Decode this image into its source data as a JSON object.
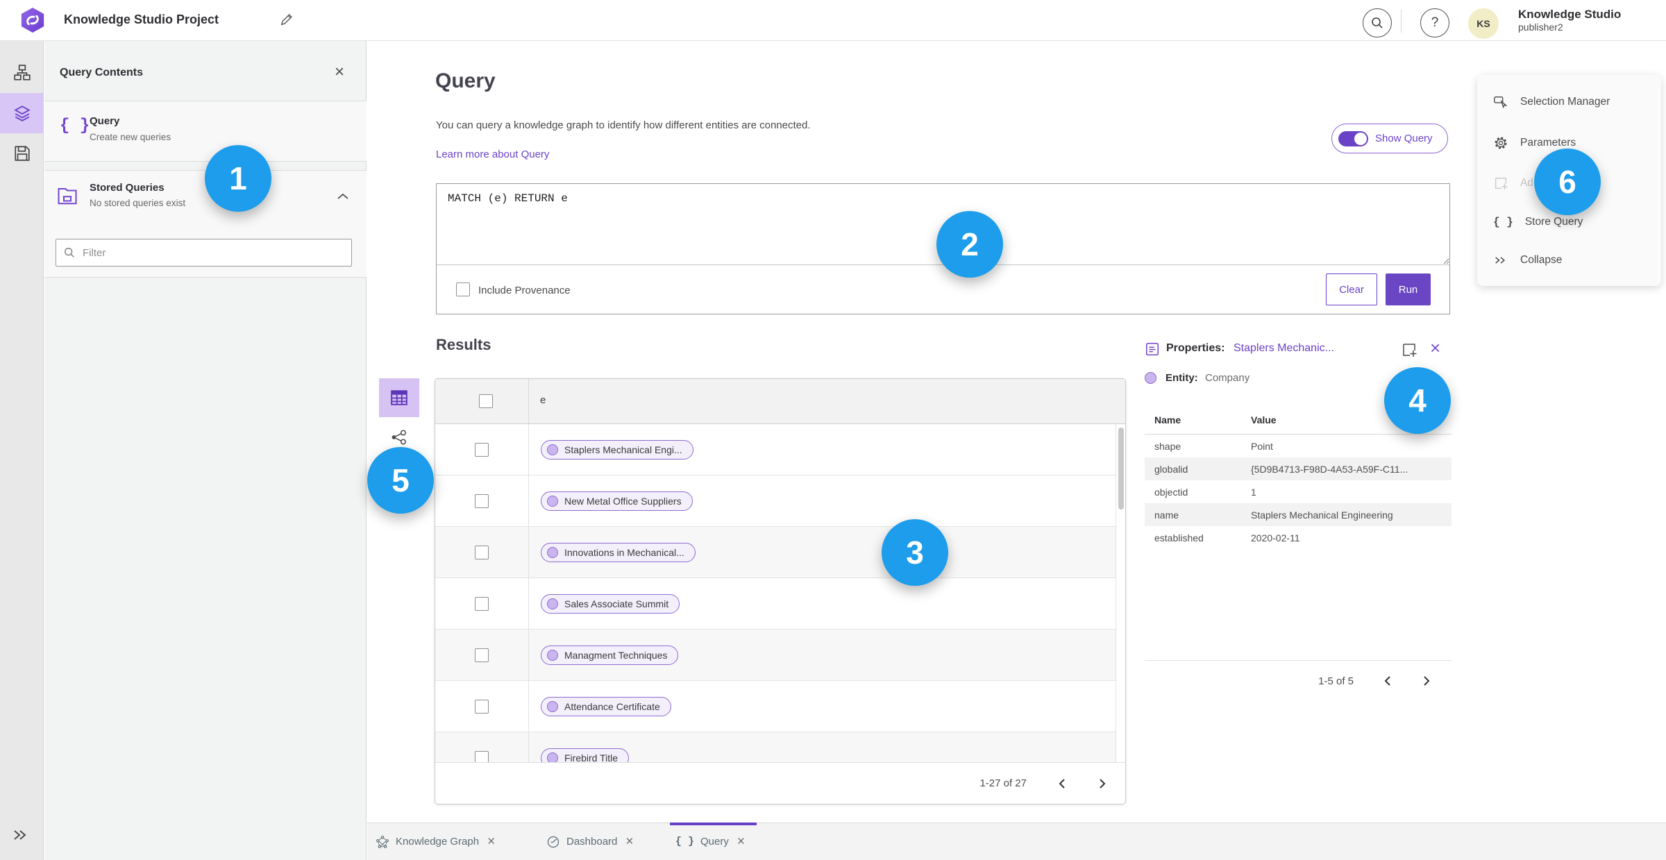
{
  "topbar": {
    "title": "Knowledge Studio Project",
    "user_name": "Knowledge Studio",
    "user_role": "publisher2",
    "avatar": "KS",
    "help_glyph": "?"
  },
  "sidebar": {
    "title": "Query Contents",
    "query_item": {
      "title": "Query",
      "subtitle": "Create new queries"
    },
    "stored_item": {
      "title": "Stored Queries",
      "subtitle": "No stored queries exist"
    },
    "filter_placeholder": "Filter",
    "braces_glyph": "{ }"
  },
  "query_panel": {
    "title": "Query",
    "description": "You can query a knowledge graph to identify how different entities are connected.",
    "learn_more": "Learn more about Query",
    "show_query": "Show Query",
    "query_text": "MATCH (e) RETURN e",
    "include_provenance": "Include Provenance",
    "clear": "Clear",
    "run": "Run"
  },
  "results": {
    "title": "Results",
    "column": "e",
    "rows": [
      "Staplers Mechanical Engi...",
      "New Metal Office Suppliers",
      "Innovations in Mechanical...",
      "Sales Associate Summit",
      "Managment Techniques",
      "Attendance Certificate",
      "Firebird Title"
    ],
    "pagination": "1-27 of 27"
  },
  "properties": {
    "label": "Properties:",
    "selected": "Staplers Mechanic...",
    "entity_label": "Entity:",
    "entity_value": "Company",
    "col_name": "Name",
    "col_value": "Value",
    "rows": [
      {
        "name": "shape",
        "value": "Point"
      },
      {
        "name": "globalid",
        "value": "{5D9B4713-F98D-4A53-A59F-C11..."
      },
      {
        "name": "objectid",
        "value": "1"
      },
      {
        "name": "name",
        "value": "Staplers Mechanical Engineering"
      },
      {
        "name": "established",
        "value": "2020-02-11"
      }
    ],
    "pagination": "1-5 of 5"
  },
  "right_menu": {
    "selection_manager": "Selection Manager",
    "parameters": "Parameters",
    "add": "Ad",
    "store_query": "Store Query",
    "collapse": "Collapse",
    "braces_glyph": "{ }"
  },
  "tabs": [
    {
      "label": "Knowledge Graph"
    },
    {
      "label": "Dashboard"
    },
    {
      "label": "Query"
    }
  ],
  "badges": {
    "b1": "1",
    "b2": "2",
    "b3": "3",
    "b4": "4",
    "b5": "5",
    "b6": "6"
  },
  "colors": {
    "accent_purple": "#6a45c4",
    "pill_border": "#8d6cd1",
    "pill_bg": "#f4f0fb",
    "badge_blue": "#1d9deb",
    "rail_selected_bg": "#d8c6f6"
  }
}
